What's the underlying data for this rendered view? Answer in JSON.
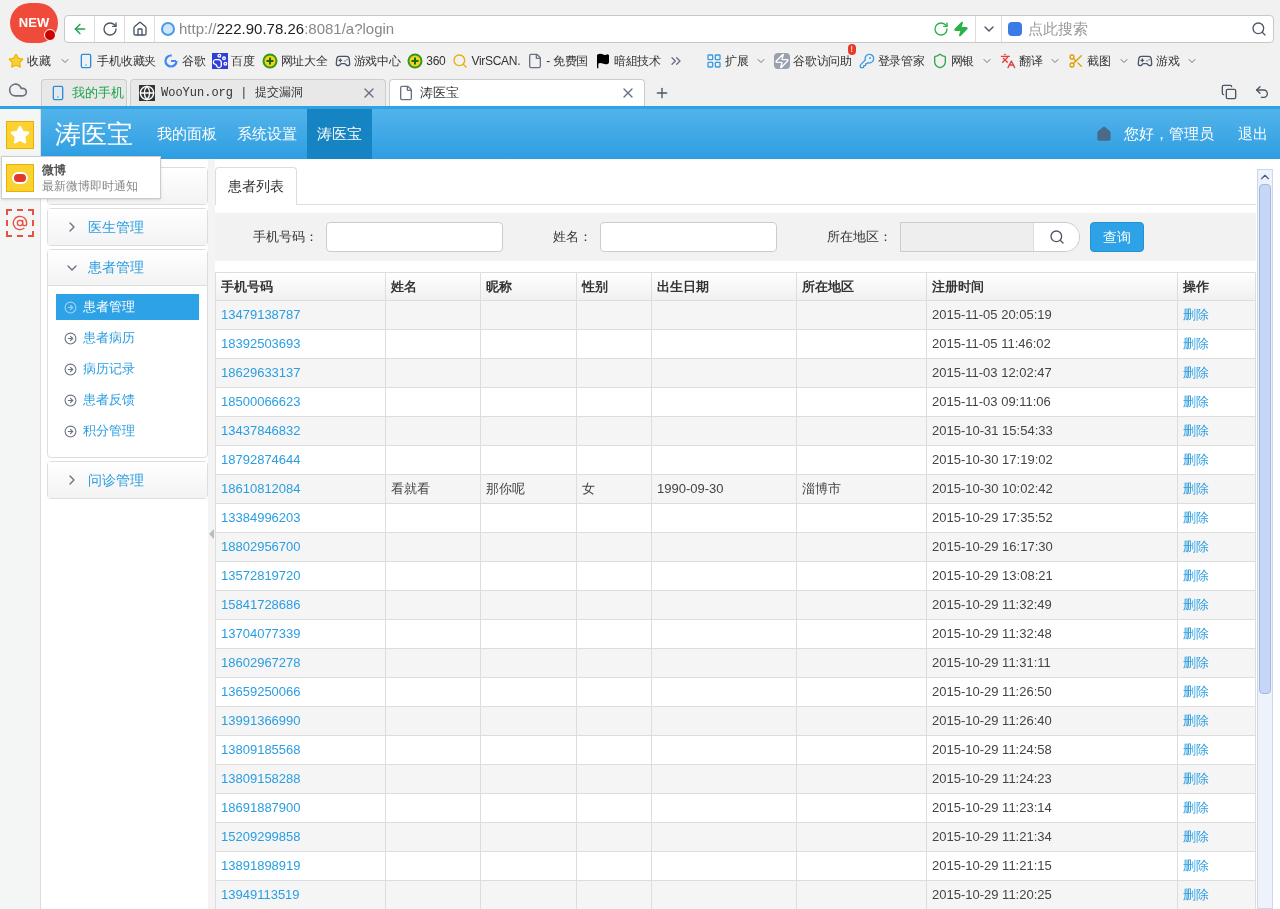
{
  "browser": {
    "logo_badge": "NEW",
    "url": {
      "host": "http://222.90.78.26",
      "path": ":8081/a?login"
    },
    "search_placeholder": "点此搜索",
    "bookmarks": [
      {
        "label": "收藏",
        "kind": "favorites"
      },
      {
        "label": "手机收藏夹",
        "kind": "phone"
      },
      {
        "label": "谷歌",
        "kind": "g"
      },
      {
        "label": "百度",
        "kind": "paw"
      },
      {
        "label": "网址大全",
        "kind": "plus"
      },
      {
        "label": "游戏中心",
        "kind": "gamepad"
      },
      {
        "label": "360",
        "kind": "plus"
      },
      {
        "label": "VirSCAN.",
        "kind": "magnifier"
      },
      {
        "label": "- 免费国",
        "kind": "page"
      },
      {
        "label": "暗組技术",
        "kind": "flag"
      }
    ],
    "extensions": [
      {
        "label": "扩展",
        "kind": "grid",
        "dropdown": true
      },
      {
        "label": "谷歌访问助",
        "kind": "bolt",
        "dropdown": false,
        "badge": "!"
      },
      {
        "label": "登录管家",
        "kind": "key",
        "dropdown": false
      },
      {
        "label": "网银",
        "kind": "shield",
        "dropdown": true
      },
      {
        "label": "翻译",
        "kind": "dict",
        "dropdown": true
      },
      {
        "label": "截图",
        "kind": "scissors",
        "dropdown": true
      },
      {
        "label": "游戏",
        "kind": "gamepad",
        "dropdown": true
      }
    ],
    "tabs": [
      {
        "label": "我的手机",
        "kind": "phone",
        "selected": false
      },
      {
        "label": "WooYun.org | 提交漏洞",
        "kind": "site",
        "selected": false
      },
      {
        "label": "涛医宝",
        "kind": "page",
        "selected": true
      }
    ]
  },
  "side_strip": {
    "popup": {
      "title": "微博",
      "text": "最新微博即时通知"
    }
  },
  "app": {
    "brand": "涛医宝",
    "nav": [
      {
        "label": "我的面板",
        "selected": false
      },
      {
        "label": "系统设置",
        "selected": false
      },
      {
        "label": "涛医宝",
        "selected": true
      }
    ],
    "greeting": "您好，管理员",
    "logout": "退出",
    "sidebar": [
      {
        "expanded": false
      },
      {
        "label": "医生管理",
        "expanded": false
      },
      {
        "label": "患者管理",
        "expanded": true,
        "children": [
          {
            "label": "患者管理",
            "selected": true
          },
          {
            "label": "患者病历",
            "selected": false
          },
          {
            "label": "病历记录",
            "selected": false
          },
          {
            "label": "患者反馈",
            "selected": false
          },
          {
            "label": "积分管理",
            "selected": false
          }
        ]
      },
      {
        "label": "问诊管理",
        "expanded": false
      }
    ],
    "tab": "患者列表",
    "filters": [
      {
        "label": "手机号码：",
        "kind": "text"
      },
      {
        "label": "姓名：",
        "kind": "text"
      },
      {
        "label": "所在地区：",
        "kind": "search"
      }
    ],
    "query_button": "查询",
    "columns": [
      "手机号码",
      "姓名",
      "昵称",
      "性别",
      "出生日期",
      "所在地区",
      "注册时间",
      "操作"
    ],
    "rows": [
      {
        "phone": "13479138787",
        "registered": "2015-11-05 20:05:19",
        "action": "删除"
      },
      {
        "phone": "18392503693",
        "registered": "2015-11-05 11:46:02",
        "action": "删除"
      },
      {
        "phone": "18629633137",
        "registered": "2015-11-03 12:02:47",
        "action": "删除"
      },
      {
        "phone": "18500066623",
        "registered": "2015-11-03 09:11:06",
        "action": "删除"
      },
      {
        "phone": "13437846832",
        "registered": "2015-10-31 15:54:33",
        "action": "删除"
      },
      {
        "phone": "18792874644",
        "registered": "2015-10-30 17:19:02",
        "action": "删除"
      },
      {
        "phone": "18610812084",
        "name": "看就看",
        "nickname": "那你呢",
        "gender": "女",
        "birth": "1990-09-30",
        "region": "淄博市",
        "registered": "2015-10-30 10:02:42",
        "action": "删除"
      },
      {
        "phone": "13384996203",
        "registered": "2015-10-29 17:35:52",
        "action": "删除"
      },
      {
        "phone": "18802956700",
        "registered": "2015-10-29 16:17:30",
        "action": "删除"
      },
      {
        "phone": "13572819720",
        "registered": "2015-10-29 13:08:21",
        "action": "删除"
      },
      {
        "phone": "15841728686",
        "registered": "2015-10-29 11:32:49",
        "action": "删除"
      },
      {
        "phone": "13704077339",
        "registered": "2015-10-29 11:32:48",
        "action": "删除"
      },
      {
        "phone": "18602967278",
        "registered": "2015-10-29 11:31:11",
        "action": "删除"
      },
      {
        "phone": "13659250066",
        "registered": "2015-10-29 11:26:50",
        "action": "删除"
      },
      {
        "phone": "13991366990",
        "registered": "2015-10-29 11:26:40",
        "action": "删除"
      },
      {
        "phone": "13809185568",
        "registered": "2015-10-29 11:24:58",
        "action": "删除"
      },
      {
        "phone": "13809158288",
        "registered": "2015-10-29 11:24:23",
        "action": "删除"
      },
      {
        "phone": "18691887900",
        "registered": "2015-10-29 11:23:14",
        "action": "删除"
      },
      {
        "phone": "15209299858",
        "registered": "2015-10-29 11:21:34",
        "action": "删除"
      },
      {
        "phone": "13891898919",
        "registered": "2015-10-29 11:21:15",
        "action": "删除"
      },
      {
        "phone": "13949113519",
        "registered": "2015-10-29 11:20:25",
        "action": "删除"
      }
    ]
  }
}
